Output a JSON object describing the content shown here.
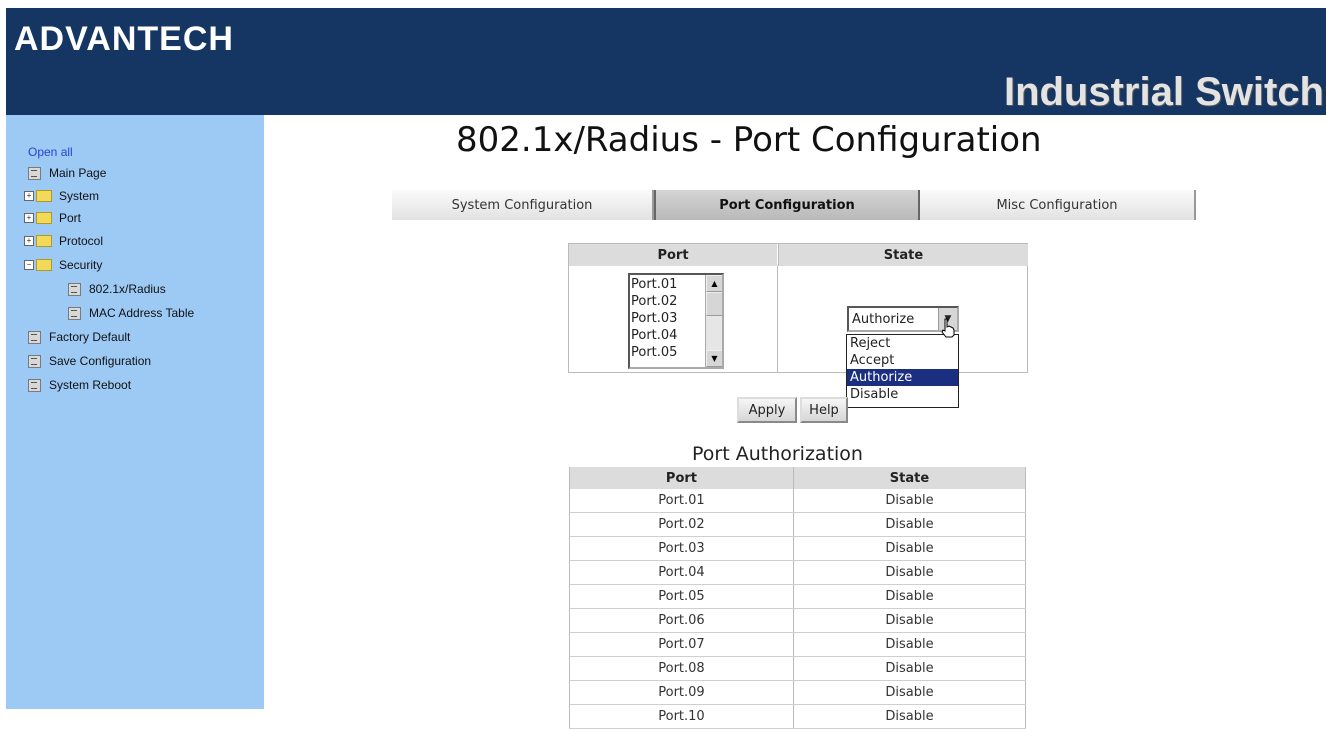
{
  "header": {
    "logo": "ADVANTECH",
    "product": "Industrial Switch"
  },
  "sidebar": {
    "open_all": "Open all",
    "items": [
      {
        "label": "Main Page",
        "icon": "page-icon"
      },
      {
        "label": "System",
        "icon": "folder-icon"
      },
      {
        "label": "Port",
        "icon": "folder-icon"
      },
      {
        "label": "Protocol",
        "icon": "folder-icon"
      },
      {
        "label": "Security",
        "icon": "folder-open-icon"
      },
      {
        "label": "802.1x/Radius",
        "icon": "page-icon"
      },
      {
        "label": "MAC Address Table",
        "icon": "page-icon"
      },
      {
        "label": "Factory Default",
        "icon": "page-icon"
      },
      {
        "label": "Save Configuration",
        "icon": "page-icon"
      },
      {
        "label": "System Reboot",
        "icon": "page-icon"
      }
    ]
  },
  "main": {
    "title": "802.1x/Radius - Port Configuration",
    "tabs": [
      {
        "label": "System Configuration"
      },
      {
        "label": "Port Configuration",
        "active": true
      },
      {
        "label": "Misc Configuration"
      }
    ],
    "config_table": {
      "headers": [
        "Port",
        "State"
      ],
      "port_options": [
        "Port.01",
        "Port.02",
        "Port.03",
        "Port.04",
        "Port.05"
      ],
      "state_selected": "Authorize",
      "state_options": [
        "Reject",
        "Accept",
        "Authorize",
        "Disable"
      ],
      "highlighted_option": "Authorize"
    },
    "buttons": {
      "apply": "Apply",
      "help": "Help"
    },
    "auth": {
      "title": "Port Authorization",
      "headers": [
        "Port",
        "State"
      ],
      "rows": [
        [
          "Port.01",
          "Disable"
        ],
        [
          "Port.02",
          "Disable"
        ],
        [
          "Port.03",
          "Disable"
        ],
        [
          "Port.04",
          "Disable"
        ],
        [
          "Port.05",
          "Disable"
        ],
        [
          "Port.06",
          "Disable"
        ],
        [
          "Port.07",
          "Disable"
        ],
        [
          "Port.08",
          "Disable"
        ],
        [
          "Port.09",
          "Disable"
        ],
        [
          "Port.10",
          "Disable"
        ]
      ]
    }
  },
  "colors": {
    "header_bg": "#153663",
    "sidebar_bg": "#9dc9f5",
    "selection": "#1b2f80"
  }
}
